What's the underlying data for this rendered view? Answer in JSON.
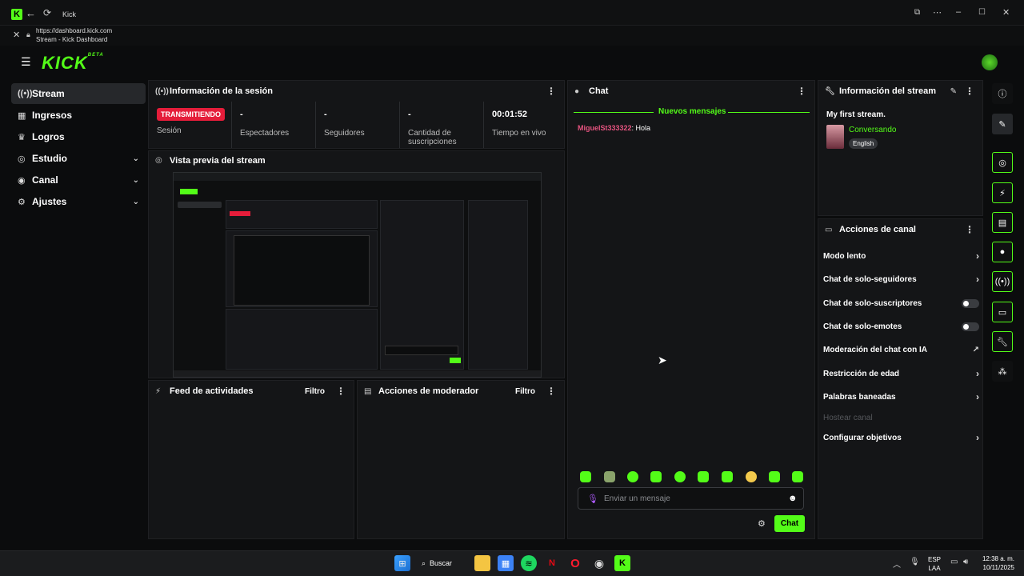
{
  "browser": {
    "tab_title": "Kick",
    "url": "https://dashboard.kick.com",
    "page_title": "Stream - Kick Dashboard"
  },
  "app": {
    "logo": "KICK",
    "logo_sup": "BETA"
  },
  "sidebar": {
    "items": [
      {
        "label": "Stream",
        "icon": "radio-icon",
        "active": true
      },
      {
        "label": "Ingresos",
        "icon": "money-icon"
      },
      {
        "label": "Logros",
        "icon": "trophy-icon"
      },
      {
        "label": "Estudio",
        "icon": "studio-icon",
        "expand": true
      },
      {
        "label": "Canal",
        "icon": "channel-icon",
        "expand": true
      },
      {
        "label": "Ajustes",
        "icon": "gear-icon",
        "expand": true
      }
    ]
  },
  "session": {
    "title": "Información de la sesión",
    "status": "TRANSMITIENDO",
    "status_label": "Sesión",
    "stats": [
      {
        "value": "-",
        "label": "Espectadores"
      },
      {
        "value": "-",
        "label": "Seguidores"
      },
      {
        "value": "-",
        "label": "Cantidad de suscripciones"
      },
      {
        "value": "00:01:52",
        "label": "Tiempo en vivo"
      }
    ]
  },
  "preview": {
    "title": "Vista previa del stream"
  },
  "feed": {
    "title": "Feed de actividades",
    "filter": "Filtro"
  },
  "mod": {
    "title": "Acciones de moderador",
    "filter": "Filtro"
  },
  "chat": {
    "title": "Chat",
    "new_messages": "Nuevos mensajes",
    "messages": [
      {
        "user": "MiguelSt333322",
        "text": "Hola"
      }
    ],
    "placeholder": "Enviar un mensaje",
    "send": "Chat"
  },
  "stream_info": {
    "title": "Información del stream",
    "stream_title": "My first stream.",
    "category": "Conversando",
    "language": "English"
  },
  "channel_actions": {
    "title": "Acciones de canal",
    "items": [
      {
        "label": "Modo lento",
        "control": "arrow"
      },
      {
        "label": "Chat de solo-seguidores",
        "control": "arrow"
      },
      {
        "label": "Chat de solo-suscriptores",
        "control": "toggle",
        "enabled": false
      },
      {
        "label": "Chat de solo-emotes",
        "control": "toggle",
        "enabled": false
      },
      {
        "label": "Moderación del chat con IA",
        "control": "external"
      },
      {
        "label": "Restricción de edad",
        "control": "arrow"
      },
      {
        "label": "Palabras baneadas",
        "control": "arrow"
      },
      {
        "label": "Hostear canal",
        "control": "none",
        "disabled": true
      },
      {
        "label": "Configurar objetivos",
        "control": "arrow"
      }
    ]
  },
  "taskbar": {
    "search": "Buscar",
    "lang1": "ESP",
    "lang2": "LAA",
    "time": "12:38 a. m.",
    "date": "10/11/2025"
  },
  "colors": {
    "accent": "#53fc18",
    "live": "#e51d3a",
    "username": "#e75480"
  }
}
